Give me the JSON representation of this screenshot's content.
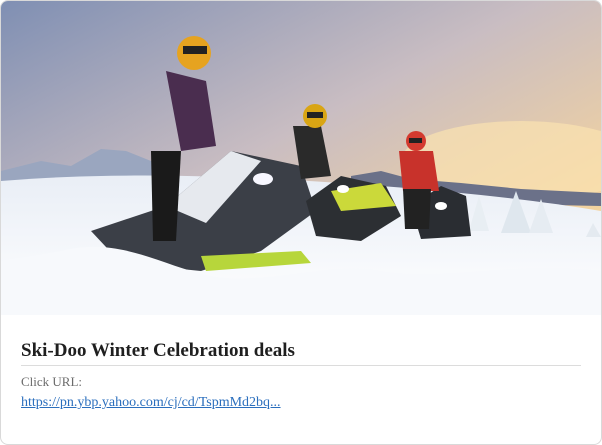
{
  "card": {
    "title": "Ski-Doo Winter Celebration deals",
    "url_label": "Click URL:",
    "url_text": "https://pn.ybp.yahoo.com/cj/cd/TspmMd2bq..."
  },
  "colors": {
    "link": "#2a6ebd",
    "title": "#1f1f1f",
    "border": "#d9d9d9"
  }
}
